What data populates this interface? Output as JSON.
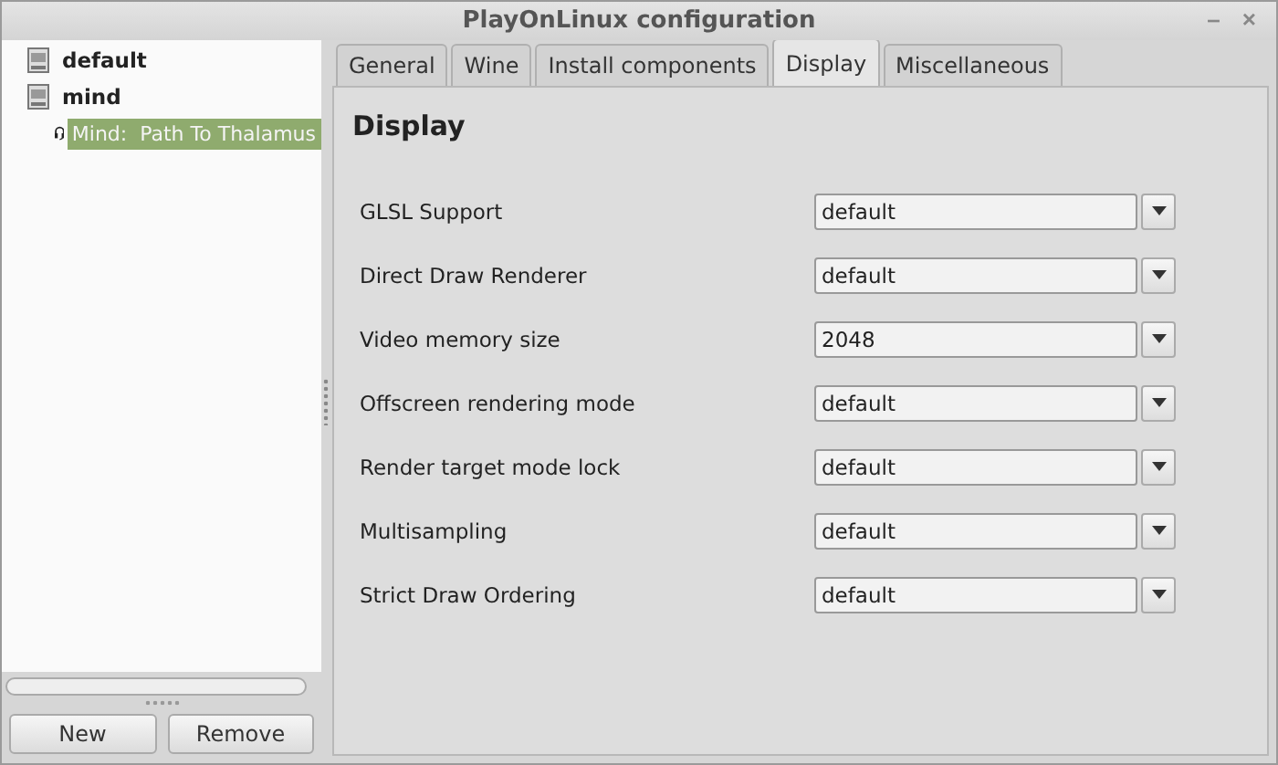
{
  "window": {
    "title": "PlayOnLinux configuration",
    "controls": [
      "–",
      "×"
    ]
  },
  "tree": [
    {
      "label": "default",
      "kind": "prefix",
      "selected": false
    },
    {
      "label": "mind",
      "kind": "prefix",
      "selected": false,
      "children": [
        {
          "label": "Mind:  Path To Thalamus",
          "kind": "app",
          "selected": true
        }
      ]
    }
  ],
  "buttons": [
    "New",
    "Remove"
  ],
  "tabs": [
    {
      "label": "General",
      "selected": false
    },
    {
      "label": "Wine",
      "selected": false
    },
    {
      "label": "Install components",
      "selected": false
    },
    {
      "label": "Display",
      "selected": true
    },
    {
      "label": "Miscellaneous",
      "selected": false
    }
  ],
  "heading": "Display",
  "settings": [
    {
      "label": "GLSL Support",
      "value": "default"
    },
    {
      "label": "Direct Draw Renderer",
      "value": "default"
    },
    {
      "label": "Video memory size",
      "value": "2048"
    },
    {
      "label": "Offscreen rendering mode",
      "value": "default"
    },
    {
      "label": "Render target mode lock",
      "value": "default"
    },
    {
      "label": "Multisampling",
      "value": "default"
    },
    {
      "label": "Strict Draw Ordering",
      "value": "default"
    }
  ]
}
